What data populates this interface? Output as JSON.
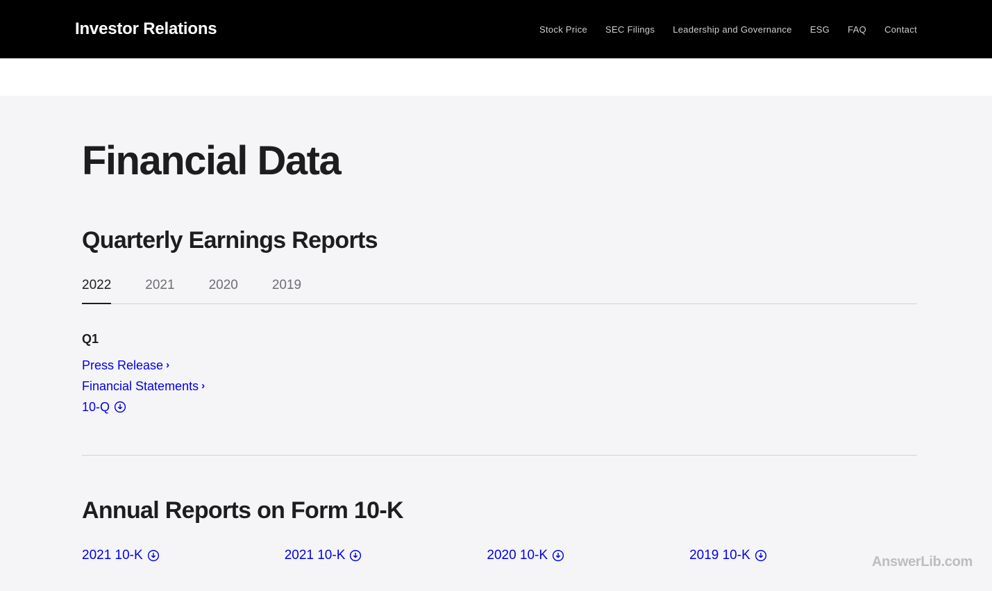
{
  "header": {
    "title": "Investor Relations",
    "nav": [
      {
        "label": "Stock Price"
      },
      {
        "label": "SEC Filings"
      },
      {
        "label": "Leadership and Governance"
      },
      {
        "label": "ESG"
      },
      {
        "label": "FAQ"
      },
      {
        "label": "Contact"
      }
    ]
  },
  "page": {
    "title": "Financial Data"
  },
  "quarterly": {
    "heading": "Quarterly Earnings Reports",
    "tabs": [
      {
        "label": "2022",
        "active": true
      },
      {
        "label": "2021",
        "active": false
      },
      {
        "label": "2020",
        "active": false
      },
      {
        "label": "2019",
        "active": false
      }
    ],
    "quarter_label": "Q1",
    "links": [
      {
        "label": "Press Release",
        "icon": "chevron"
      },
      {
        "label": "Financial Statements",
        "icon": "chevron"
      },
      {
        "label": "10-Q",
        "icon": "download"
      }
    ]
  },
  "annual": {
    "heading": "Annual Reports on Form 10-K",
    "reports": [
      {
        "label": "2021 10-K"
      },
      {
        "label": "2021 10-K"
      },
      {
        "label": "2020 10-K"
      },
      {
        "label": "2019 10-K"
      }
    ]
  },
  "watermark": "AnswerLib.com"
}
